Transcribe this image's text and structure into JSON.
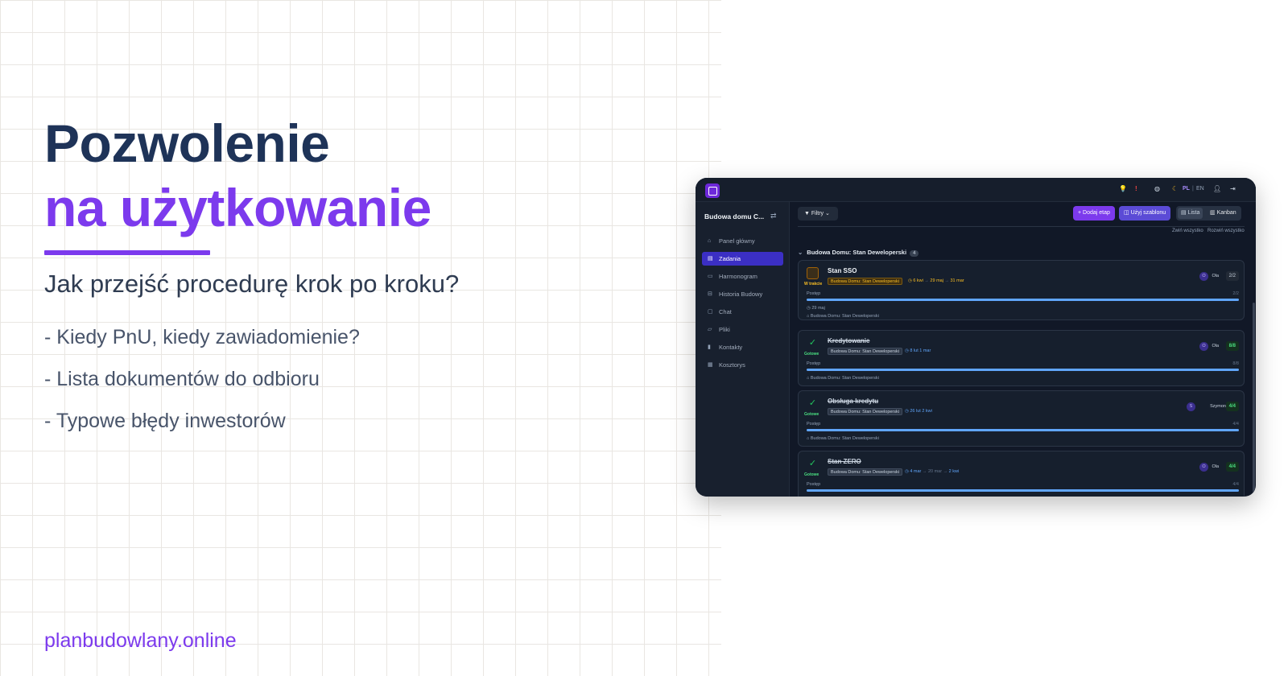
{
  "headline": {
    "line1": "Pozwolenie",
    "line2": "na użytkowanie",
    "subtitle": "Jak przejść procedurę krok po kroku?",
    "bullets": [
      "- Kiedy PnU, kiedy zawiadomienie?",
      "- Lista dokumentów do odbioru",
      "- Typowe błędy inwestorów"
    ],
    "site": "planbudowlany.online"
  },
  "colors": {
    "navy": "#1e3358",
    "accent": "#7c3aed",
    "app_bg": "#111827"
  },
  "app": {
    "topbar": {
      "icons": [
        "lightbulb-icon",
        "alert-icon",
        "globe-icon",
        "moon-icon",
        "user-icon",
        "logout-icon"
      ],
      "lang_pl": "PL",
      "lang_sep": "|",
      "lang_en": "EN"
    },
    "sidebar": {
      "project": "Budowa domu C...",
      "items": [
        {
          "label": "Panel główny",
          "icon": "home-icon"
        },
        {
          "label": "Zadania",
          "icon": "clipboard-icon",
          "active": true
        },
        {
          "label": "Harmonogram",
          "icon": "calendar-icon"
        },
        {
          "label": "Historia Budowy",
          "icon": "book-icon"
        },
        {
          "label": "Chat",
          "icon": "chat-icon"
        },
        {
          "label": "Pliki",
          "icon": "folder-icon"
        },
        {
          "label": "Kontakty",
          "icon": "contacts-icon"
        },
        {
          "label": "Kosztorys",
          "icon": "calculator-icon"
        }
      ]
    },
    "toolbar": {
      "filters": "Filtry",
      "add_stage": "+ Dodaj etap",
      "use_template": "Użyj szablonu",
      "view_list": "Lista",
      "view_kanban": "Kanban",
      "collapse_all": "Zwiń wszystko",
      "expand_all": "Rozwiń wszystko"
    },
    "group": {
      "title": "Budowa Domu: Stan Deweloperski",
      "count": "4"
    },
    "cards": [
      {
        "title": "Stan SSO",
        "status": "W trakcie",
        "state": "progress",
        "tag": "Budowa Domu: Stan Deweloperski",
        "date_start": "6 kwi",
        "date_mid": "29 maj",
        "date_end": "31 mar",
        "avatar": "O",
        "assignee": "Ola",
        "count": "2/2",
        "progress_label": "Postęp",
        "progress_value": "2/2",
        "progress": 1.0,
        "due": "29 maj",
        "footer": "Budowa Domu: Stan Deweloperski"
      },
      {
        "title": "Kredytowanie",
        "status": "Gotowe",
        "state": "done",
        "tag": "Budowa Domu: Stan Deweloperski",
        "date_start": "8 lut",
        "date_end": "1 mar",
        "avatar": "O",
        "assignee": "Ola",
        "count": "8/8",
        "progress_label": "Postęp",
        "progress_value": "8/8",
        "progress": 1.0,
        "footer": "Budowa Domu: Stan Deweloperski"
      },
      {
        "title": "Obsługa kredytu",
        "status": "Gotowe",
        "state": "done",
        "tag": "Budowa Domu: Stan Deweloperski",
        "date_start": "26 lut",
        "date_end": "2 kwi",
        "avatar": "S",
        "assignee": "Szymon",
        "count": "4/4",
        "progress_label": "Postęp",
        "progress_value": "4/4",
        "progress": 1.0,
        "footer": "Budowa Domu: Stan Deweloperski"
      },
      {
        "title": "Stan ZERO",
        "status": "Gotowe",
        "state": "done",
        "tag": "Budowa Domu: Stan Deweloperski",
        "date_start": "4 mar",
        "date_mid": "20 mar",
        "date_end": "2 kwi",
        "avatar": "O",
        "assignee": "Ola",
        "count": "4/4",
        "progress_label": "Postęp",
        "progress_value": "4/4",
        "progress": 1.0
      }
    ]
  }
}
